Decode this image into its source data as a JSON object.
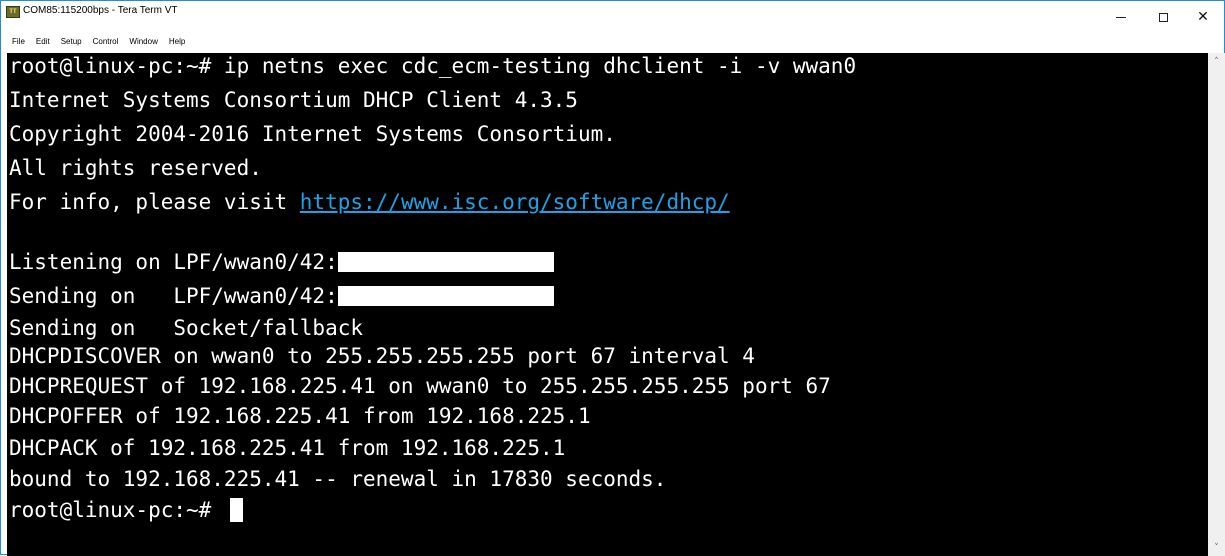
{
  "window": {
    "title": "COM85:115200bps - Tera Term VT",
    "icon": "teraterm-app-icon",
    "controls": {
      "minimize": "minimize-icon",
      "maximize": "maximize-icon",
      "close": "close-icon"
    }
  },
  "menubar": {
    "items": [
      "File",
      "Edit",
      "Setup",
      "Control",
      "Window",
      "Help"
    ]
  },
  "terminal": {
    "background": "#000000",
    "foreground": "#ffffff",
    "link_color": "#1aa3e8",
    "lines": [
      "root@linux-pc:~# ip netns exec cdc_ecm-testing dhclient -i -v wwan0",
      "Internet Systems Consortium DHCP Client 4.3.5",
      "Copyright 2004-2016 Internet Systems Consortium.",
      "All rights reserved.",
      "For info, please visit ",
      "",
      "Listening on LPF/wwan0/42:",
      "Sending on   LPF/wwan0/42:",
      "Sending on   Socket/fallback",
      "DHCPDISCOVER on wwan0 to 255.255.255.255 port 67 interval 4",
      "DHCPREQUEST of 192.168.225.41 on wwan0 to 255.255.255.255 port 67",
      "DHCPOFFER of 192.168.225.41 from 192.168.225.1",
      "DHCPACK of 192.168.225.41 from 192.168.225.1",
      "bound to 192.168.225.41 -- renewal in 17830 seconds.",
      "root@linux-pc:~# "
    ],
    "info_link": "https://www.isc.org/software/dhcp/"
  },
  "scrollbar": {
    "up": "scroll-up-arrow-icon",
    "down": "scroll-down-arrow-icon"
  }
}
